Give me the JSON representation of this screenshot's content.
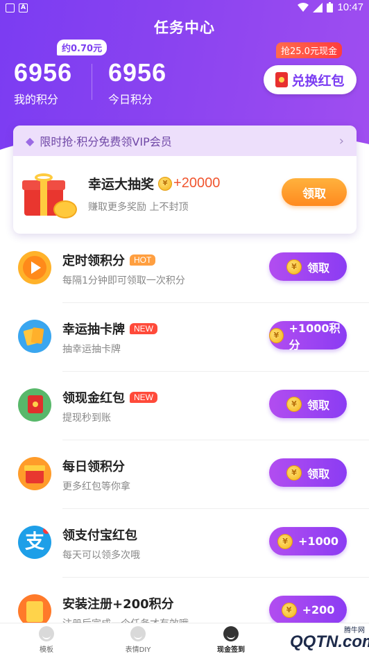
{
  "status_bar": {
    "time": "10:47",
    "left_icon_1": "A"
  },
  "header": {
    "title": "任务中心",
    "approx_badge": "约0.70元",
    "my_points_value": "6956",
    "my_points_label": "我的积分",
    "today_points_value": "6956",
    "today_points_label": "今日积分",
    "cash_tag": "抢25.0元现金",
    "exchange_label": "兑换红包"
  },
  "vip_card": {
    "banner": "限时抢·积分免费领VIP会员",
    "lottery_title": "幸运大抽奖",
    "lottery_bonus": "+20000",
    "lottery_sub": "赚取更多奖励 上不封顶",
    "claim_label": "领取"
  },
  "tasks": [
    {
      "title": "定时领积分",
      "tag": "HOT",
      "sub": "每隔1分钟即可领取一次积分",
      "button": "领取",
      "icon": "play-icon"
    },
    {
      "title": "幸运抽卡牌",
      "tag": "NEW",
      "sub": "抽幸运抽卡牌",
      "button": "+1000积分",
      "icon": "cards-icon"
    },
    {
      "title": "领现金红包",
      "tag": "NEW",
      "sub": "提现秒到账",
      "button": "领取",
      "icon": "red-envelope-icon"
    },
    {
      "title": "每日领积分",
      "tag": "",
      "sub": "更多红包等你拿",
      "button": "领取",
      "icon": "gift-box-icon"
    },
    {
      "title": "领支付宝红包",
      "tag": "",
      "sub": "每天可以领多次哦",
      "button": "+1000",
      "icon": "alipay-icon"
    },
    {
      "title": "安装注册+200积分",
      "tag": "",
      "sub": "注册后完成一个任务才有效哦",
      "button": "+200",
      "icon": "install-icon"
    }
  ],
  "coin_glyph": "¥",
  "alipay_glyph": "支",
  "bottom_nav": {
    "items": [
      {
        "label": "模板"
      },
      {
        "label": "表情DIY"
      },
      {
        "label": "现金签到"
      }
    ]
  },
  "watermark": {
    "main": "QQTN.com",
    "top": "腾牛网"
  },
  "colors": {
    "header_purple": "#7b3cf2",
    "button_purple": "#9a44f1",
    "claim_orange": "#ff9a2a",
    "tag_hot": "#ff9f40",
    "tag_new": "#ff4a3a"
  }
}
